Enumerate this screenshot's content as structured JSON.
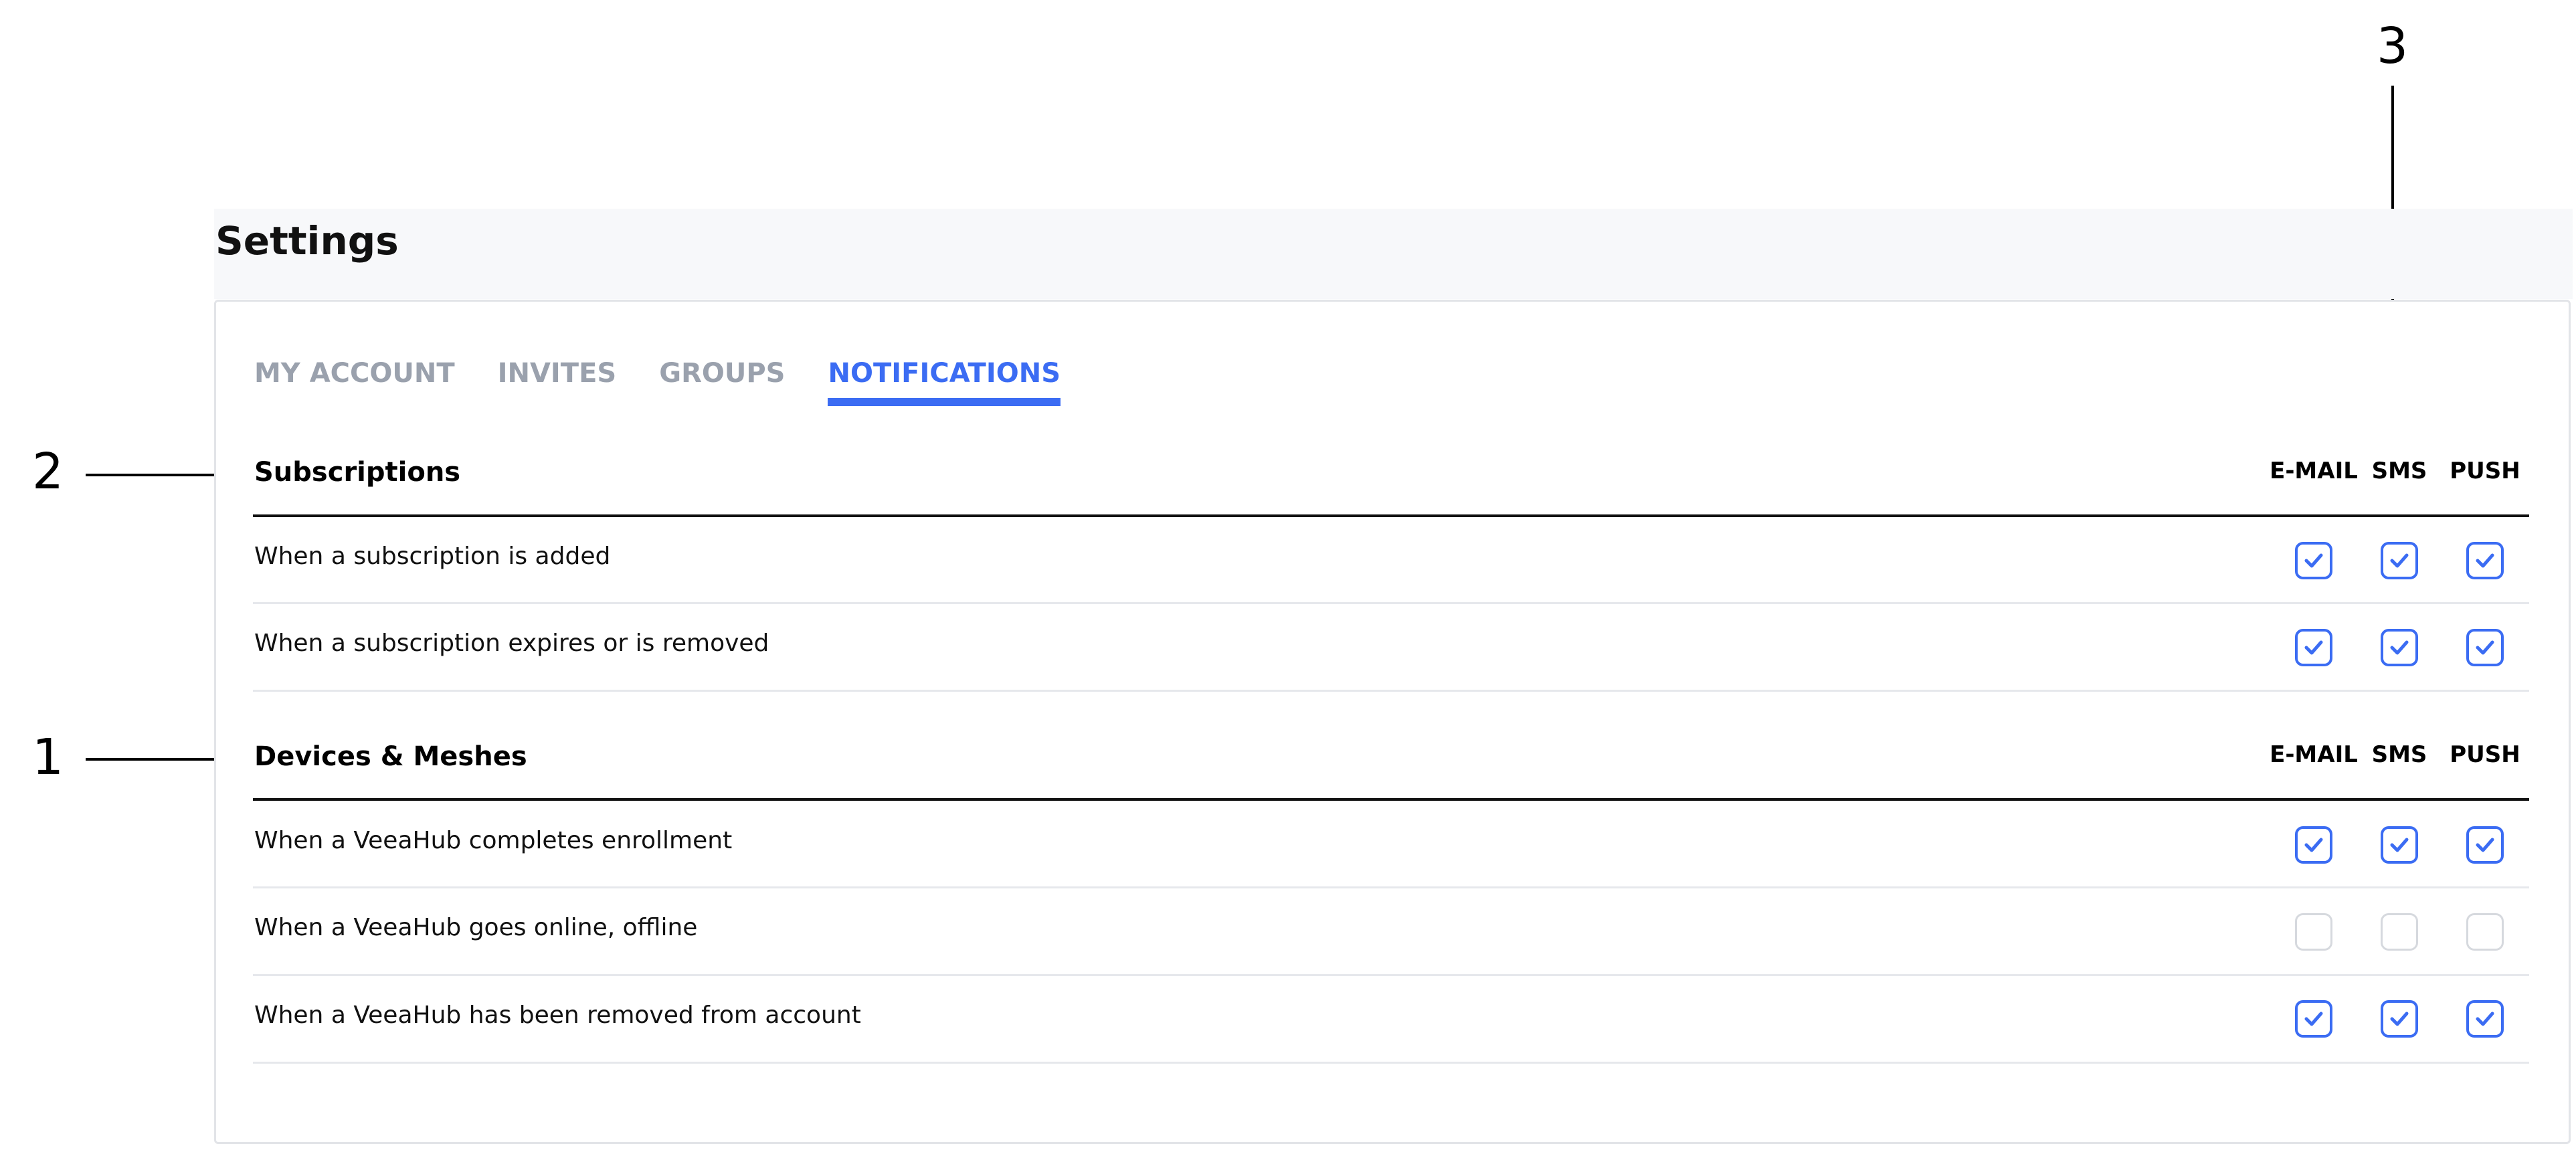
{
  "callouts": [
    "3",
    "2",
    "1"
  ],
  "page": {
    "title": "Settings"
  },
  "tabs": [
    {
      "label": "MY ACCOUNT",
      "active": false
    },
    {
      "label": "INVITES",
      "active": false
    },
    {
      "label": "GROUPS",
      "active": false
    },
    {
      "label": "NOTIFICATIONS",
      "active": true
    }
  ],
  "columns": [
    "E-MAIL",
    "SMS",
    "PUSH"
  ],
  "sections": [
    {
      "title": "Subscriptions",
      "rows": [
        {
          "label": "When a subscription is added",
          "email": true,
          "sms": true,
          "push": true
        },
        {
          "label": "When a subscription expires or is removed",
          "email": true,
          "sms": true,
          "push": true
        }
      ]
    },
    {
      "title": "Devices & Meshes",
      "rows": [
        {
          "label": "When a VeeaHub completes enrollment",
          "email": true,
          "sms": true,
          "push": true
        },
        {
          "label": "When a VeeaHub goes online, offline",
          "email": false,
          "sms": false,
          "push": false
        },
        {
          "label": "When a VeeaHub has been removed from account",
          "email": true,
          "sms": true,
          "push": true
        }
      ]
    }
  ],
  "colors": {
    "accent": "#3b6cf3",
    "tab_inactive": "#9aa1ad",
    "checkbox_off_border": "#d6d9de"
  },
  "icons": {
    "checkbox_checked": "check-icon"
  }
}
